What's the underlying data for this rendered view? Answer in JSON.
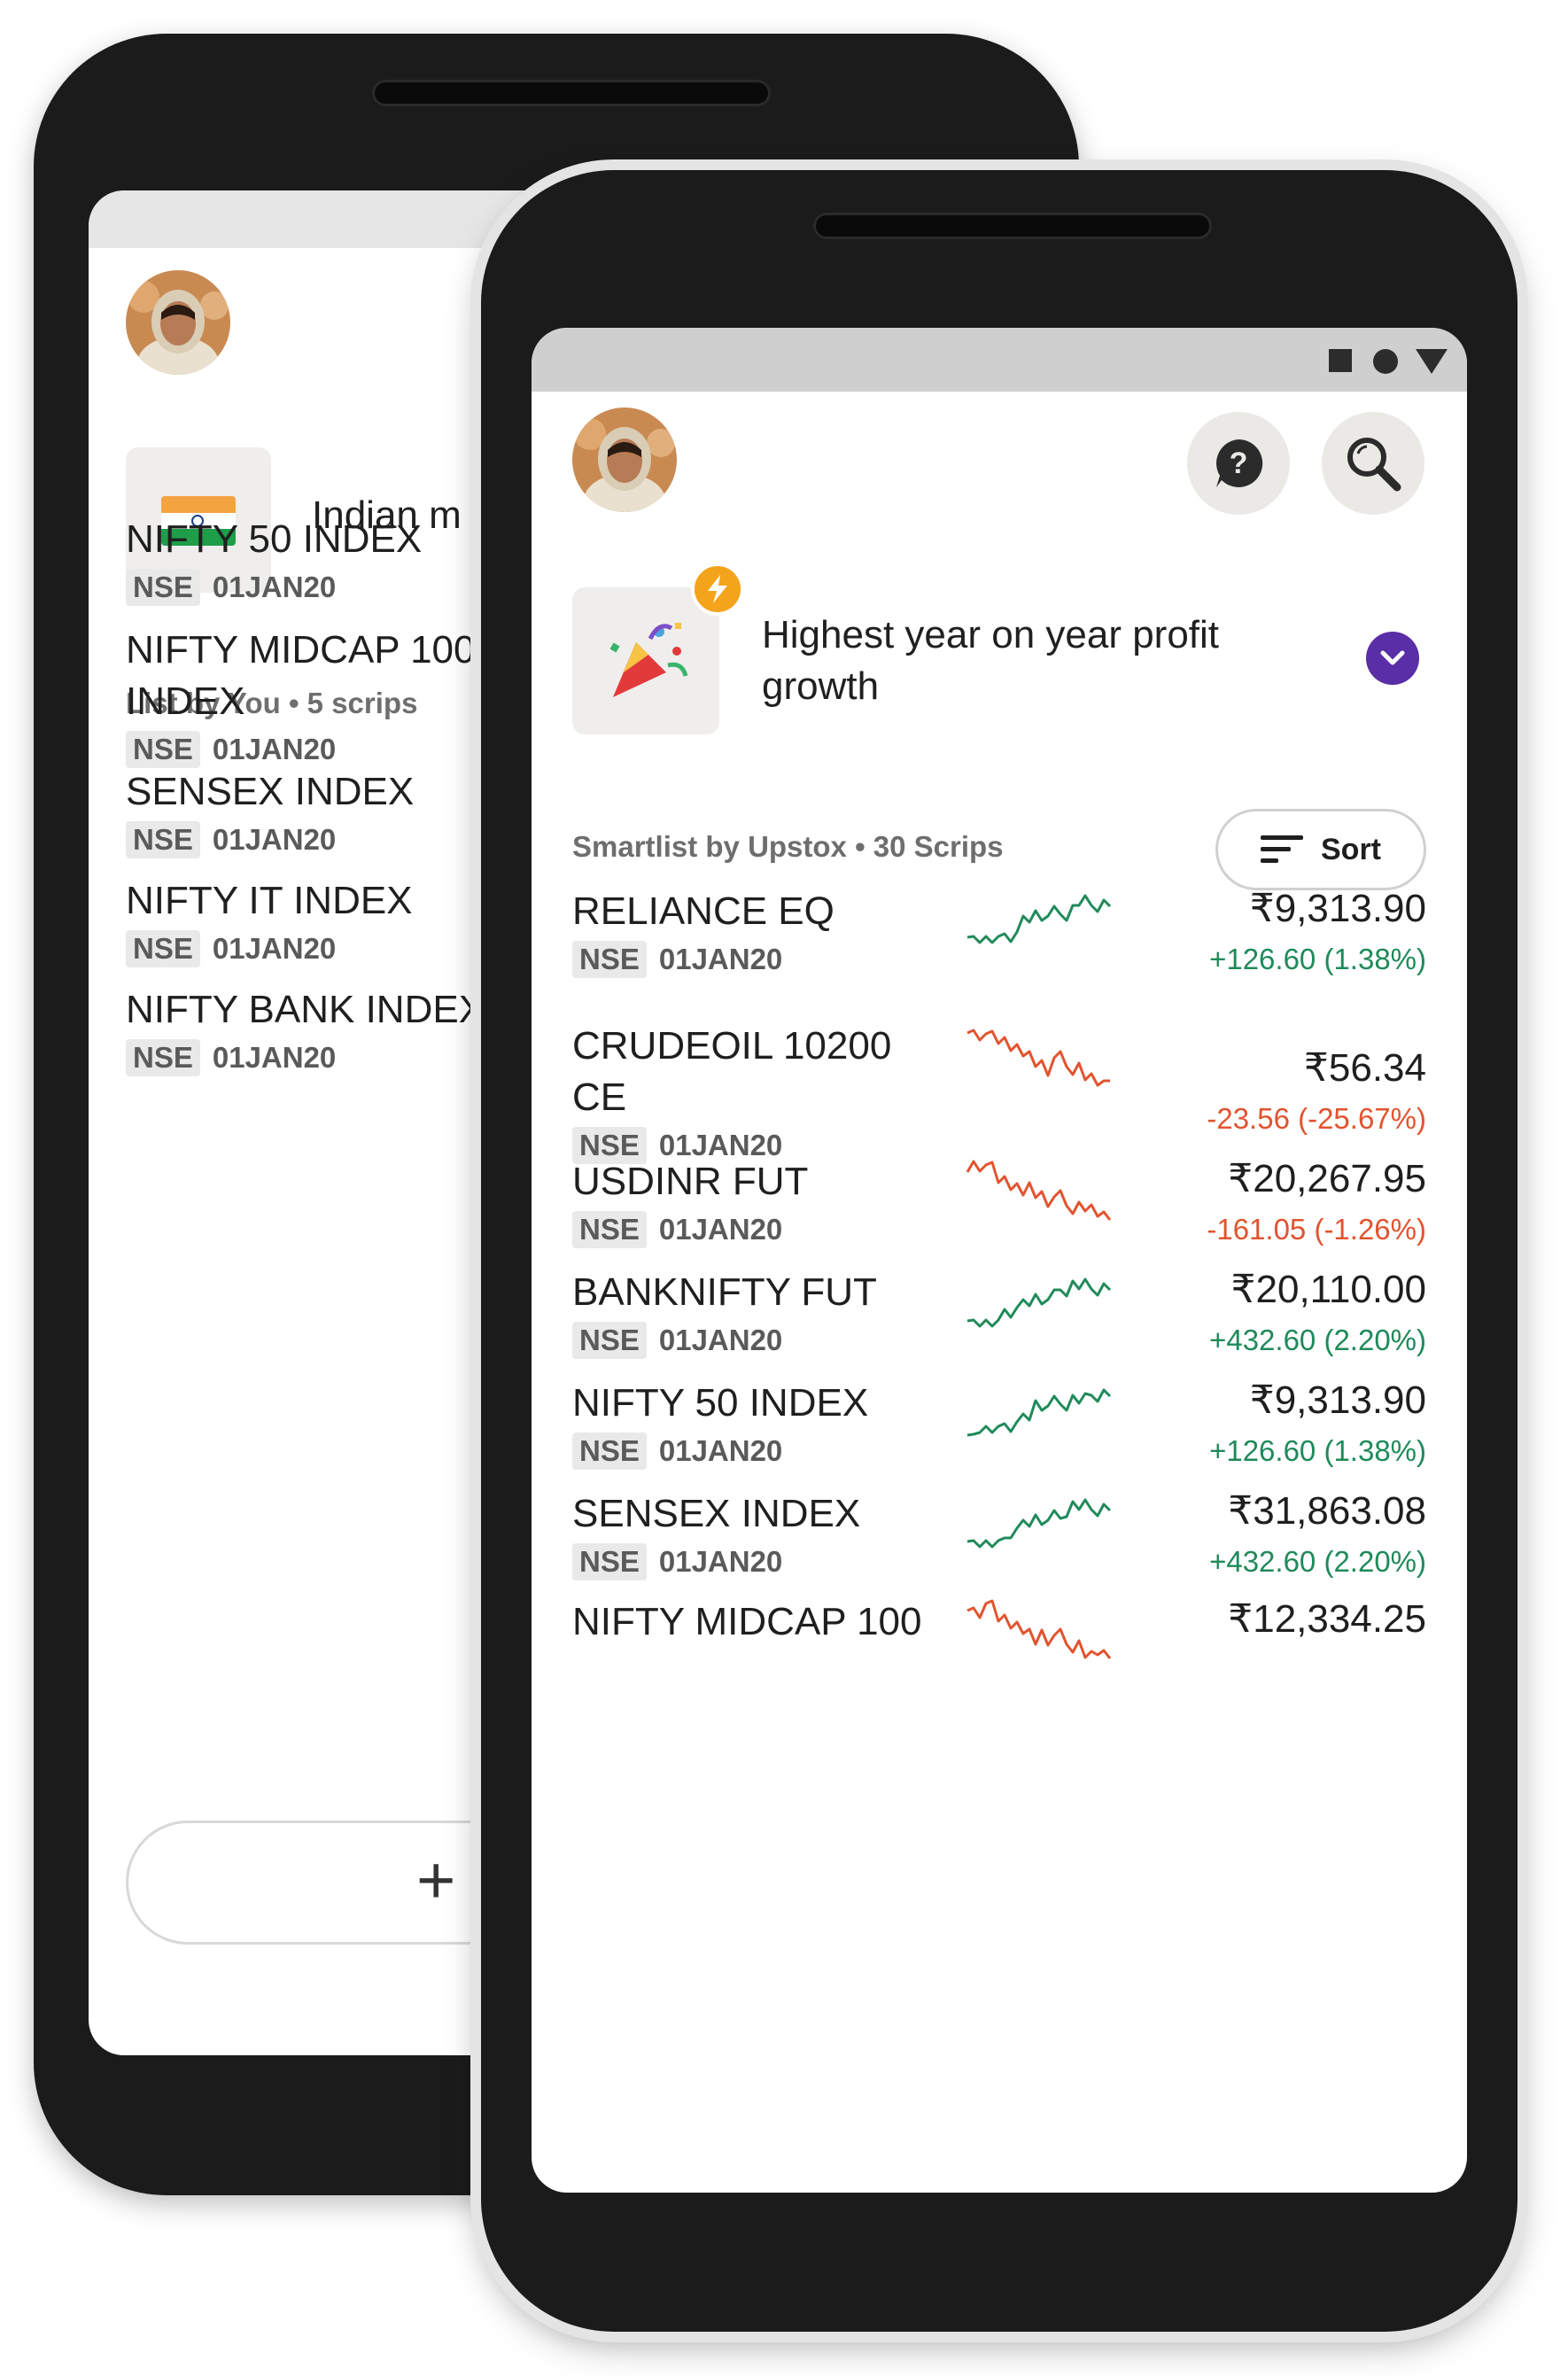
{
  "back_screen": {
    "market_label": "Indian m",
    "list_label": "List by You • 5 scrips",
    "items": [
      {
        "name_lines": [
          "NIFTY 50 INDEX"
        ],
        "exchange": "NSE",
        "date": "01JAN20"
      },
      {
        "name_lines": [
          "NIFTY MIDCAP 100",
          "INDEX"
        ],
        "exchange": "NSE",
        "date": "01JAN20"
      },
      {
        "name_lines": [
          "SENSEX INDEX"
        ],
        "exchange": "NSE",
        "date": "01JAN20"
      },
      {
        "name_lines": [
          "NIFTY IT INDEX"
        ],
        "exchange": "NSE",
        "date": "01JAN20"
      },
      {
        "name_lines": [
          "NIFTY BANK INDEX"
        ],
        "exchange": "NSE",
        "date": "01JAN20"
      }
    ],
    "add_button_icon": "plus-icon"
  },
  "front_screen": {
    "banner": {
      "title": "Highest year on year profit growth",
      "icon": "party-popper-icon",
      "badge_icon": "lightning-icon"
    },
    "smartlist_label": "Smartlist by Upstox • 30 Scrips",
    "sort_label": "Sort",
    "rows": [
      {
        "name_lines": [
          "RELIANCE EQ"
        ],
        "exchange": "NSE",
        "date": "01JAN20",
        "price": "₹9,313.90",
        "change": "+126.60  (1.38%)",
        "direction": "up"
      },
      {
        "name_lines": [
          "CRUDEOIL 10200",
          "CE"
        ],
        "exchange": "NSE",
        "date": "01JAN20",
        "price": "₹56.34",
        "change": "-23.56 (-25.67%)",
        "direction": "down"
      },
      {
        "name_lines": [
          "USDINR FUT"
        ],
        "exchange": "NSE",
        "date": "01JAN20",
        "price": "₹20,267.95",
        "change": "-161.05 (-1.26%)",
        "direction": "down"
      },
      {
        "name_lines": [
          "BANKNIFTY FUT"
        ],
        "exchange": "NSE",
        "date": "01JAN20",
        "price": "₹20,110.00",
        "change": "+432.60 (2.20%)",
        "direction": "up"
      },
      {
        "name_lines": [
          "NIFTY 50 INDEX"
        ],
        "exchange": "NSE",
        "date": "01JAN20",
        "price": "₹9,313.90",
        "change": "+126.60  (1.38%)",
        "direction": "up"
      },
      {
        "name_lines": [
          "SENSEX INDEX"
        ],
        "exchange": "NSE",
        "date": "01JAN20",
        "price": "₹31,863.08",
        "change": "+432.60 (2.20%)",
        "direction": "up"
      },
      {
        "name_lines": [
          "NIFTY MIDCAP 100"
        ],
        "exchange": "",
        "date": "",
        "price": "₹12,334.25",
        "change": "",
        "direction": "down"
      }
    ]
  },
  "colors": {
    "up": "#1f8a5a",
    "down": "#e1542f",
    "accent_purple": "#5a2ea6",
    "badge_orange": "#f4a41b"
  }
}
